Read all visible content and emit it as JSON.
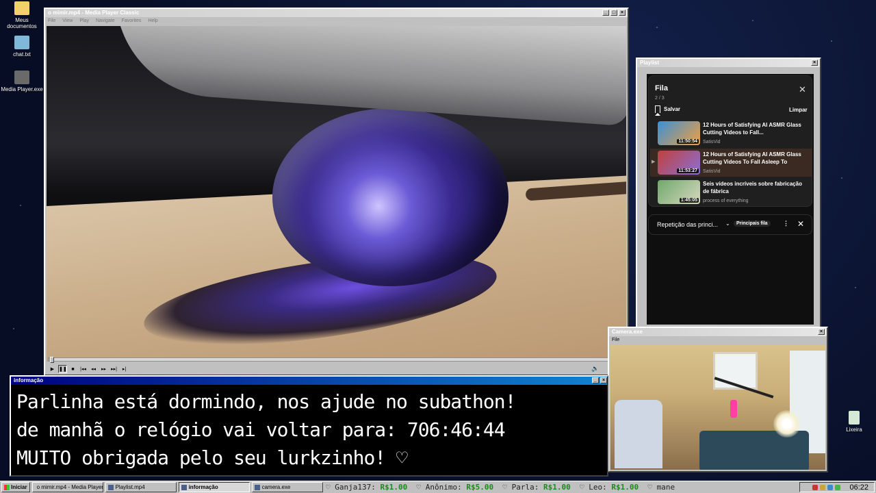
{
  "desktop_icons": [
    {
      "label": "Meus documentos",
      "icon": "folder-icon",
      "color": "#f2d16b"
    },
    {
      "label": "chat.txt",
      "icon": "notepad-icon",
      "color": "#7fb8d8"
    },
    {
      "label": "Media Player.exe",
      "icon": "media-player-icon",
      "color": "#6a6a6a"
    },
    {
      "label": "Lixeira",
      "icon": "recycle-bin-icon",
      "color": "#d6e8d6"
    }
  ],
  "media_player": {
    "title": "o mimir.mp4 - Media Player Classic",
    "menu": [
      "File",
      "View",
      "Play",
      "Navigate",
      "Favorites",
      "Help"
    ],
    "progress_fraction": 0.004,
    "controls": [
      "play",
      "pause",
      "stop",
      "prev",
      "rew",
      "ffw",
      "next",
      "frame-step"
    ]
  },
  "playlist": {
    "title": "Playlist",
    "queue_title": "Fila",
    "queue_count": "2 / 3",
    "save_label": "Salvar",
    "clear_label": "Limpar",
    "items": [
      {
        "title": "12 Hours of Satisfying AI ASMR Glass Cutting Videos to Fall...",
        "channel": "SatisVid",
        "duration": "11:50:54",
        "active": false,
        "thumb_color": "#3b8fd6"
      },
      {
        "title": "12 Hours of Satisfying AI ASMR Glass Cutting Videos To Fall Asleep To",
        "channel": "SatisVid",
        "duration": "11:53:27",
        "active": true,
        "thumb_color": "#c0413a"
      },
      {
        "title": "Seis vídeos incríveis sobre fabricação de fábrica",
        "channel": "process of everything",
        "duration": "1:45:05",
        "active": false,
        "thumb_color": "#6fa86a"
      }
    ],
    "play_marker": "▶",
    "repeat_label": "Repetição das princi...",
    "chip_label": "Principais fila",
    "accent": "#3a2a22"
  },
  "info_window": {
    "title": "informação",
    "lines": [
      "Parlinha está dormindo, nos ajude no subathon!",
      "de manhã o relógio vai voltar para:  706:46:44",
      "MUITO obrigada pelo seu lurkzinho! ♡"
    ]
  },
  "camera_window": {
    "title": "Camera.exe",
    "menu": "File"
  },
  "taskbar": {
    "start_label": "Iniciar",
    "items": [
      {
        "label": "o mimir.mp4 - Media Player...",
        "active": false
      },
      {
        "label": "Playlist.mp4",
        "active": false
      },
      {
        "label": "informação",
        "active": true
      },
      {
        "label": "camera.exe",
        "active": false
      }
    ],
    "ticker": [
      {
        "name": "Ganja137:",
        "amount": "R$1.00"
      },
      {
        "name": "Anônimo:",
        "amount": "R$5.00"
      },
      {
        "name": "Parla:",
        "amount": "R$1.00"
      },
      {
        "name": "Leo:",
        "amount": "R$1.00"
      },
      {
        "name": "mane",
        "amount": ""
      }
    ],
    "ticker_heart": "♡",
    "clock": "06:22"
  }
}
